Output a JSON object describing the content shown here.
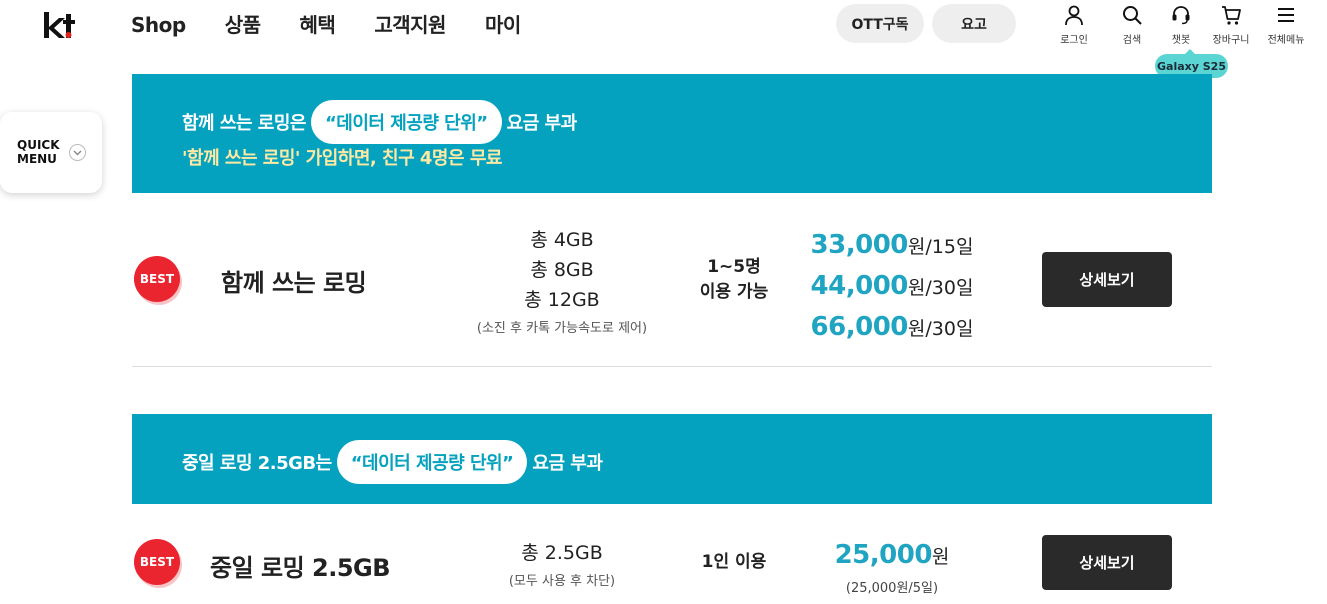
{
  "header": {
    "logo_text": "kt",
    "nav": [
      "Shop",
      "상품",
      "혜택",
      "고객지원",
      "마이"
    ],
    "ott_label": "OTT구독",
    "yogo_label": "요고",
    "utils": [
      {
        "label": "로그인",
        "icon": "person-icon"
      },
      {
        "label": "검색",
        "icon": "search-icon"
      },
      {
        "label": "챗봇",
        "icon": "headset-icon"
      },
      {
        "label": "장바구니",
        "icon": "cart-icon"
      },
      {
        "label": "전체메뉴",
        "icon": "menu-icon"
      }
    ],
    "tooltip": "Galaxy S25"
  },
  "quick_menu": {
    "label": "QUICK\nMENU",
    "icon": "chevron-down-icon"
  },
  "banner1": {
    "line1_before": "함께 쓰는 로밍은",
    "line1_chip": "“데이터 제공량 단위”",
    "line1_after": "요금 부과",
    "line2": "'함께 쓰는 로밍' 가입하면, 친구 4명은 무료"
  },
  "plan1": {
    "badge": "BEST",
    "name": "함께 쓰는 로밍",
    "data": [
      "총 4GB",
      "총 8GB",
      "총 12GB"
    ],
    "data_note": "(소진 후 카톡 가능속도로 제어)",
    "users_line1": "1~5명",
    "users_line2": "이용 가능",
    "prices": [
      {
        "amount": "33,000",
        "unit": "원/15일"
      },
      {
        "amount": "44,000",
        "unit": "원/30일"
      },
      {
        "amount": "66,000",
        "unit": "원/30일"
      }
    ],
    "button": "상세보기"
  },
  "banner2": {
    "line1_before": "중일 로밍 2.5GB는",
    "line1_chip": "“데이터 제공량 단위”",
    "line1_after": "요금 부과"
  },
  "plan2": {
    "badge": "BEST",
    "name": "중일 로밍 2.5GB",
    "data": [
      "총 2.5GB"
    ],
    "data_note": "(모두 사용 후 차단)",
    "users_line1": "1인 이용",
    "price_amount": "25,000",
    "price_unit": "원",
    "price_note": "(25,000원/5일)",
    "button": "상세보기"
  },
  "colors": {
    "banner": "#04a2be",
    "price": "#1fa5c2",
    "best_badge": "#ea2530",
    "tooltip": "#5ad5d3",
    "button": "#2a2a2a"
  }
}
